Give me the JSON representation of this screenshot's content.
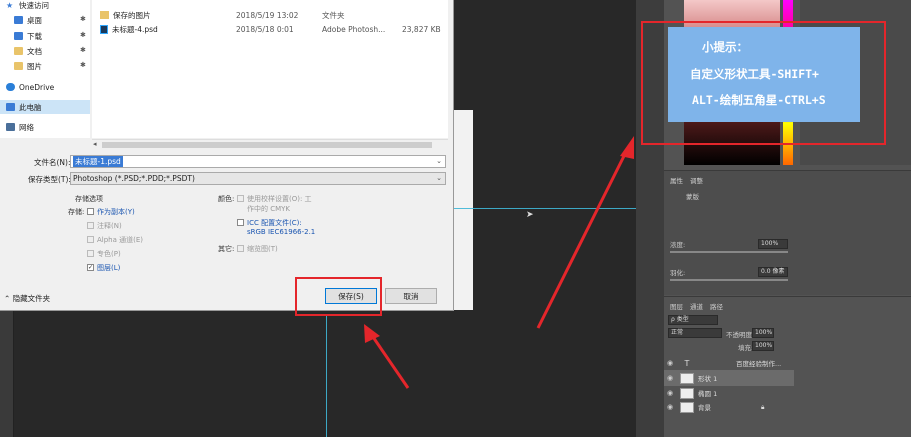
{
  "nav": {
    "quick_access": "快速访问",
    "desktop": "桌面",
    "downloads": "下载",
    "documents": "文档",
    "pictures": "图片",
    "onedrive": "OneDrive",
    "this_pc": "此电脑",
    "network": "网络"
  },
  "files": [
    {
      "name": "保存的图片",
      "date": "2018/5/19 13:02",
      "type": "文件夹",
      "size": ""
    },
    {
      "name": "未标题-4.psd",
      "date": "2018/5/18 0:01",
      "type": "Adobe Photosh...",
      "size": "23,827 KB"
    }
  ],
  "form": {
    "filename_label": "文件名(N):",
    "filename_value": "未标题-1.psd",
    "filetype_label": "保存类型(T):",
    "filetype_value": "Photoshop (*.PSD;*.PDD;*.PSDT)"
  },
  "options": {
    "title": "存储选项",
    "storage_label": "存储:",
    "as_copy": "作为副本(Y)",
    "notes": "注释(N)",
    "alpha": "Alpha 通道(E)",
    "spot": "专色(P)",
    "layers": "图层(L)",
    "color_label": "颜色:",
    "use_proof": "使用校样设置(O): 工",
    "use_proof_2": "作中的 CMYK",
    "icc": "ICC 配置文件(C):",
    "icc_2": "sRGB IEC61966-2.1",
    "other_label": "其它:",
    "thumbnail": "缩览图(T)"
  },
  "footer": {
    "hide_folders": "隐藏文件夹",
    "save": "保存(S)",
    "cancel": "取消"
  },
  "tip": {
    "line1": "小提示：",
    "line2": "自定义形状工具-SHIFT+",
    "line3": "ALT-绘制五角星-CTRL+S"
  },
  "properties": {
    "tab1": "属性",
    "tab2": "调整",
    "mask": "蒙版",
    "density_label": "浓度:",
    "density_value": "100%",
    "feather_label": "羽化:",
    "feather_value": "0.0 像素"
  },
  "layers": {
    "tab1": "图层",
    "tab2": "通道",
    "tab3": "路径",
    "kind": "ρ 类型",
    "mode": "正常",
    "opacity_label": "不透明度:",
    "opacity_value": "100%",
    "fill_label": "填充:",
    "fill_value": "100%",
    "rows": [
      {
        "name": "百度经验制作...",
        "kind": "T"
      },
      {
        "name": "形状 1",
        "kind": "shape"
      },
      {
        "name": "椭圆 1",
        "kind": "shape"
      },
      {
        "name": "背景",
        "kind": "bg"
      }
    ]
  },
  "colors": {
    "annotation_red": "#e4262b",
    "tip_bg": "#7fb4ea",
    "guide": "#3fb6d6"
  }
}
